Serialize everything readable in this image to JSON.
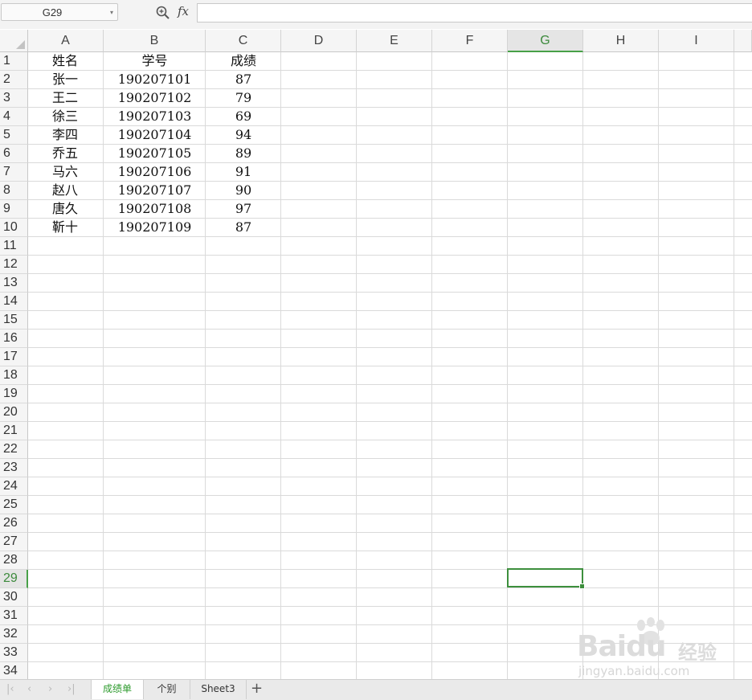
{
  "formula_bar": {
    "name_box": "G29",
    "fx_label": "fx",
    "formula": ""
  },
  "columns": [
    "A",
    "B",
    "C",
    "D",
    "E",
    "F",
    "G",
    "H",
    "I"
  ],
  "selected_column": "G",
  "rows": [
    "1",
    "2",
    "3",
    "4",
    "5",
    "6",
    "7",
    "8",
    "9",
    "10",
    "11",
    "12",
    "13",
    "14",
    "15",
    "16",
    "17",
    "18",
    "19",
    "20",
    "21",
    "22",
    "23",
    "24",
    "25",
    "26",
    "27",
    "28",
    "29",
    "30",
    "31",
    "32",
    "33",
    "34"
  ],
  "selected_row": "29",
  "table": {
    "headers": {
      "name": "姓名",
      "student_id": "学号",
      "score": "成绩"
    },
    "records": [
      {
        "name": "张一",
        "student_id": "190207101",
        "score": "87"
      },
      {
        "name": "王二",
        "student_id": "190207102",
        "score": "79"
      },
      {
        "name": "徐三",
        "student_id": "190207103",
        "score": "69"
      },
      {
        "name": "李四",
        "student_id": "190207104",
        "score": "94"
      },
      {
        "name": "乔五",
        "student_id": "190207105",
        "score": "89"
      },
      {
        "name": "马六",
        "student_id": "190207106",
        "score": "91"
      },
      {
        "name": "赵八",
        "student_id": "190207107",
        "score": "90"
      },
      {
        "name": "唐久",
        "student_id": "190207108",
        "score": "97"
      },
      {
        "name": "靳十",
        "student_id": "190207109",
        "score": "87"
      }
    ]
  },
  "sheet_tabs": [
    {
      "label": "成绩单",
      "active": true
    },
    {
      "label": "个别",
      "active": false
    },
    {
      "label": "Sheet3",
      "active": false
    }
  ],
  "add_sheet_label": "+",
  "watermark": {
    "logo": "Baidu",
    "cn": "经验",
    "url": "jingyan.baidu.com"
  },
  "colors": {
    "selection": "#3d8f3d",
    "active_tab_text": "#2e9b2e"
  }
}
